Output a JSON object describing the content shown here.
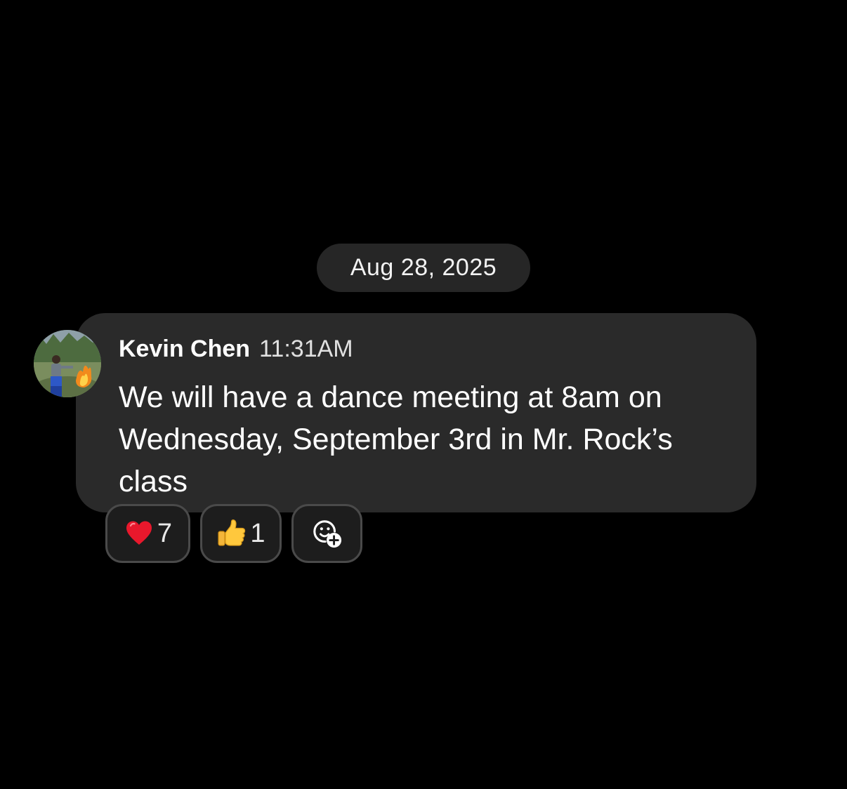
{
  "date_separator": "Aug 28, 2025",
  "message": {
    "sender": "Kevin Chen",
    "time": "11:31AM",
    "text": "We will have a dance meeting at 8am on Wednesday, September 3rd in Mr. Rock’s class",
    "avatar_icon": "user-photo-avatar"
  },
  "reactions": [
    {
      "emoji_icon": "red-heart-icon",
      "count": "7"
    },
    {
      "emoji_icon": "thumbs-up-icon",
      "count": "1"
    },
    {
      "emoji_icon": "add-reaction-icon"
    }
  ],
  "colors": {
    "background": "#000000",
    "bubble": "#2a2a2a",
    "date_pill": "#262626",
    "reaction_border": "#4a4a4a"
  }
}
